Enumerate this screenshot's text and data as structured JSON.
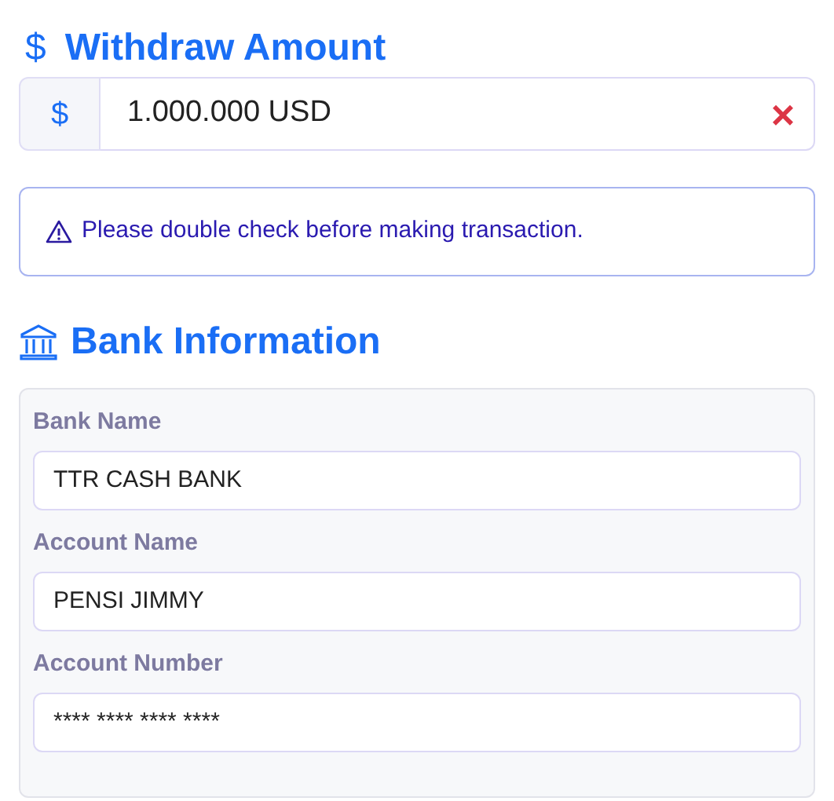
{
  "withdraw": {
    "icon": "$",
    "title": "Withdraw Amount",
    "prefix": "$",
    "value": "1.000.000 USD",
    "clear": "×"
  },
  "alert": {
    "text": "Please double check before making transaction."
  },
  "bank": {
    "title": "Bank Information",
    "fields": [
      {
        "label": "Bank Name",
        "value": "TTR CASH BANK"
      },
      {
        "label": "Account Name",
        "value": "PENSI JIMMY"
      },
      {
        "label": "Account Number",
        "value": "**** **** **** ****"
      }
    ]
  }
}
